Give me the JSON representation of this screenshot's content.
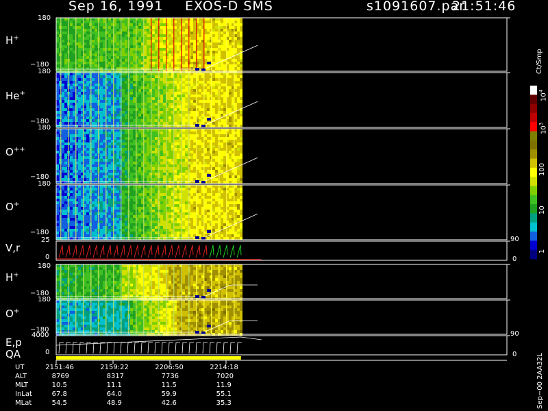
{
  "header": {
    "date": "Sep 16, 1991",
    "mission": "EXOS-D SMS",
    "file": "s1091607.par",
    "time": "21:51:46"
  },
  "colors": {
    "background": "#000000",
    "frame": "#ffffff",
    "scale": [
      "#000080",
      "#0000d0",
      "#1060e0",
      "#00c0d0",
      "#00a080",
      "#20a020",
      "#40c020",
      "#80d000",
      "#d0e000",
      "#ffff00",
      "#d0c000",
      "#a09000",
      "#807000",
      "#808000",
      "#ff0000",
      "#c00000",
      "#900000",
      "#600000",
      "#ffffff"
    ]
  },
  "chart_data": {
    "type": "heatmap",
    "panels": [
      {
        "id": "H+",
        "label": "H",
        "sup": "+",
        "ymax": "180",
        "ymin": "−180"
      },
      {
        "id": "He+",
        "label": "He",
        "sup": "+",
        "ymax": "180",
        "ymin": "−180"
      },
      {
        "id": "O++",
        "label": "O",
        "sup": "++",
        "ymax": "180",
        "ymin": "−180"
      },
      {
        "id": "O+",
        "label": "O",
        "sup": "+",
        "ymax": "180",
        "ymin": "−180"
      },
      {
        "id": "Vr",
        "label": "V,r",
        "sup": "",
        "ymax": "25",
        "ymin": "0",
        "right_top": "90",
        "right_bot": "0"
      },
      {
        "id": "H+2",
        "label": "H",
        "sup": "+",
        "ymax": "180",
        "ymin": "−180"
      },
      {
        "id": "O+2",
        "label": "O",
        "sup": "+",
        "ymax": "180",
        "ymin": "−180"
      },
      {
        "id": "Ep",
        "label": "E,p",
        "sup": "",
        "ymax": "4000",
        "ymin": "0",
        "right_top": "90",
        "right_bot": "0"
      }
    ],
    "qa_label": "QA",
    "colorbar": {
      "unit": "Ct/Smp",
      "scale": "log",
      "labels": [
        {
          "text": "10",
          "sup": "4"
        },
        {
          "text": "10",
          "sup": "3"
        },
        {
          "text": "100",
          "sup": ""
        },
        {
          "text": "10",
          "sup": ""
        },
        {
          "text": "1",
          "sup": ""
        }
      ]
    },
    "data_coverage_fraction": 0.41,
    "time_axis": {
      "rows": [
        {
          "name": "UT",
          "values": [
            "2151:46",
            "2159:22",
            "2206:50",
            "2214:18"
          ]
        },
        {
          "name": "ALT",
          "values": [
            "8769",
            "8317",
            "7736",
            "7020"
          ]
        },
        {
          "name": "MLT",
          "values": [
            "10.5",
            "11.1",
            "11.5",
            "11.9"
          ]
        },
        {
          "name": "InLat",
          "values": [
            "67.8",
            "64.0",
            "59.9",
            "55.1"
          ]
        },
        {
          "name": "MLat",
          "values": [
            "54.5",
            "48.9",
            "42.6",
            "35.3"
          ]
        }
      ]
    },
    "footer_code": "Sep−00 2AA32L"
  }
}
